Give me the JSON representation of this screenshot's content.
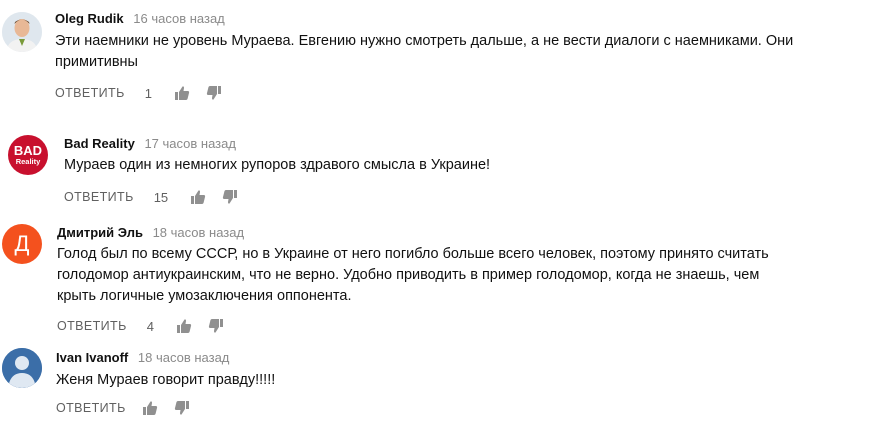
{
  "comments": [
    {
      "author": "Oleg Rudik",
      "time": "16 часов назад",
      "text": "Эти наемники не уровень Мураева. Евгению нужно смотреть дальше, а не вести диалоги с наемниками. Они примитивны",
      "reply_label": "ОТВЕТИТЬ",
      "likes": "1"
    },
    {
      "author": "Bad Reality",
      "time": "17 часов назад",
      "text": "Мураев один из немногих рупоров здравого смысла в Украине!",
      "reply_label": "ОТВЕТИТЬ",
      "likes": "15",
      "avatar_text_top": "BAD",
      "avatar_text_bottom": "Reality"
    },
    {
      "author": "Дмитрий Эль",
      "time": "18 часов назад",
      "text": "Голод был по всему СССР, но в Украине от него погибло больше всего человек, поэтому принято считать голодомор антиукраинским, что не верно. Удобно приводить в пример голодомор, когда не знаешь, чем крыть логичные умозаключения оппонента.",
      "reply_label": "ОТВЕТИТЬ",
      "likes": "4",
      "avatar_letter": "Д"
    },
    {
      "author": "Ivan Ivanoff",
      "time": "18 часов назад",
      "text": "Женя Мураев говорит правду!!!!!",
      "reply_label": "ОТВЕТИТЬ"
    }
  ],
  "colors": {
    "bad_reality_avatar": "#c8102e",
    "dmitry_avatar": "#f4511e",
    "ivan_avatar": "#3b6ea8",
    "meta_text": "#606060",
    "time_text": "#8a8a8a"
  },
  "icons": [
    "like-icon",
    "dislike-icon"
  ]
}
